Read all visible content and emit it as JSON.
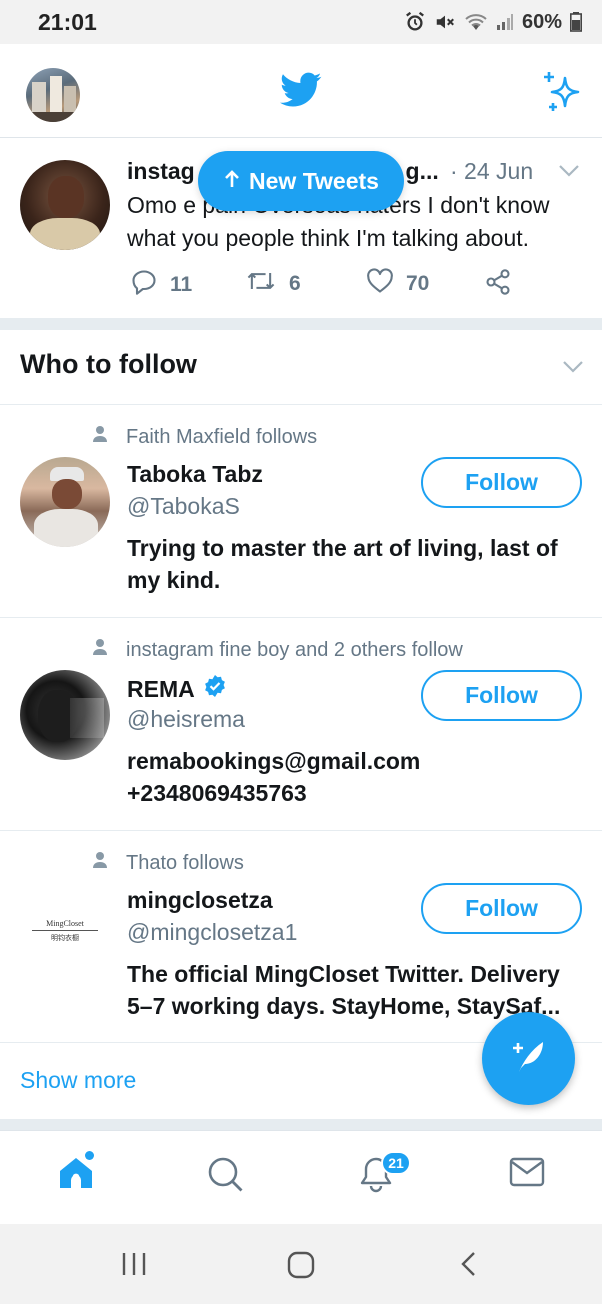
{
  "status_bar": {
    "time": "21:01",
    "battery": "60%",
    "icons": [
      "alarm-icon",
      "mute-icon",
      "wifi-icon",
      "signal-icon",
      "battery-icon"
    ]
  },
  "app_bar": {
    "logo": "twitter-bird-icon",
    "sparkle": "sparkle-icon"
  },
  "tweet": {
    "author": "instag",
    "author_tail": "g...",
    "date": "· 24 Jun",
    "text": "Omo e pain Overseas haters I don't know what you people think I'm talking about.",
    "replies": "11",
    "retweets": "6",
    "likes": "70"
  },
  "new_tweets_pill": "New Tweets",
  "who_to_follow": {
    "title": "Who to follow",
    "users": [
      {
        "context": "Faith Maxfield follows",
        "name": "Taboka Tabz",
        "handle": "@TabokaS",
        "bio": "Trying to master the art of living, last of my kind.",
        "follow_label": "Follow",
        "verified": false
      },
      {
        "context": "instagram fine boy and 2 others follow",
        "name": "REMA",
        "handle": "@heisrema",
        "bio": "remabookings@gmail.com +2348069435763",
        "follow_label": "Follow",
        "verified": true
      },
      {
        "context": "Thato follows",
        "name": "mingclosetza",
        "handle": "@mingclosetza1",
        "bio": "The official MingCloset Twitter. Delivery 5–7 working days. StayHome, StaySaf...",
        "follow_label": "Follow",
        "verified": false,
        "avatar_text": "MingCloset",
        "avatar_subtext": "明钧衣橱"
      }
    ],
    "show_more": "Show more"
  },
  "bottom_nav": {
    "items": [
      "home-icon",
      "search-icon",
      "notifications-icon",
      "messages-icon"
    ],
    "notification_count": "21"
  },
  "colors": {
    "accent": "#1da1f2",
    "secondary_text": "#657786",
    "primary_text": "#14171a",
    "divider": "#e6ecf0"
  }
}
